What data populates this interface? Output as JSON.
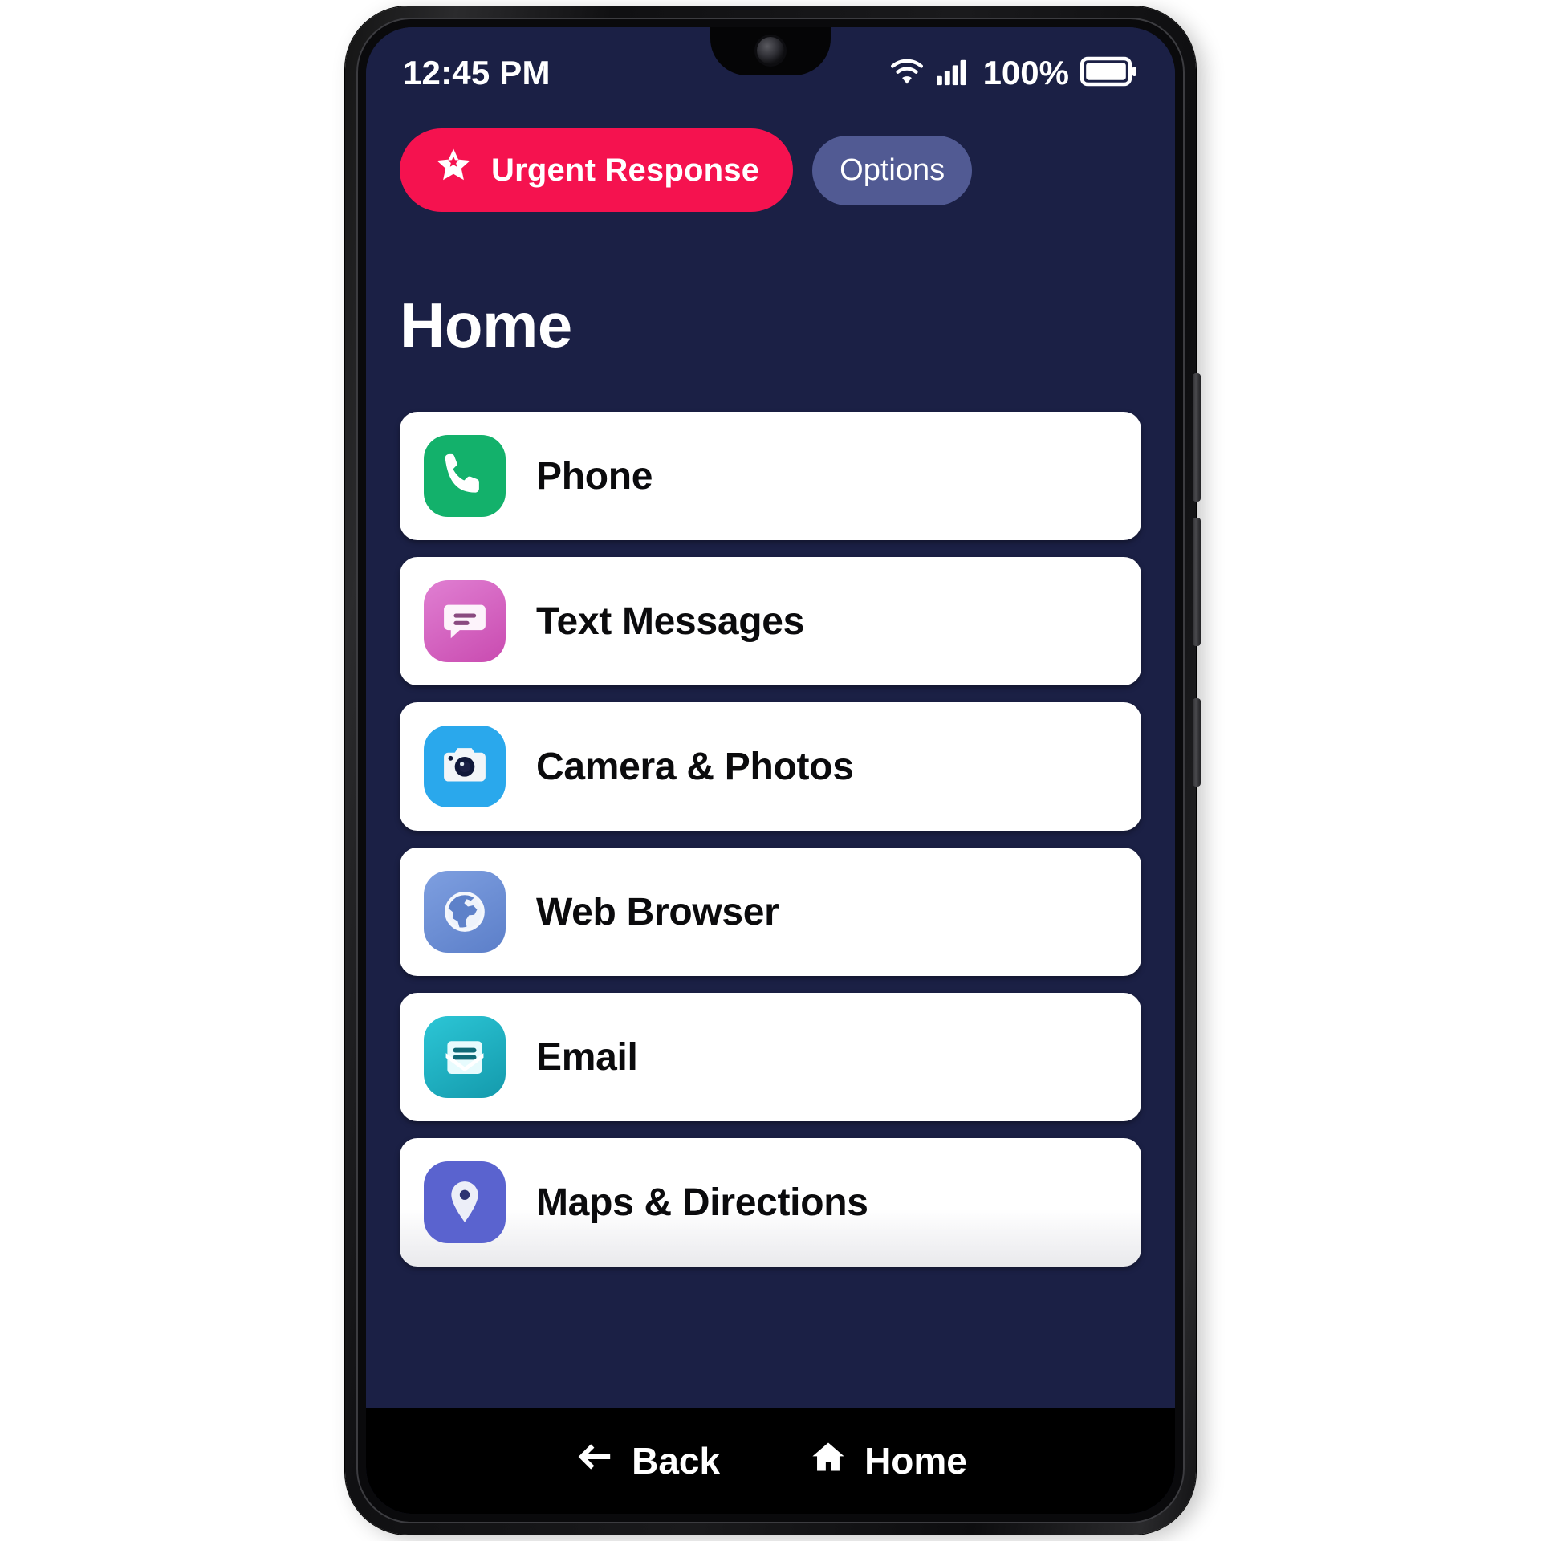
{
  "device": {
    "label": "smartphone",
    "side_buttons": [
      "volume-up",
      "volume-down",
      "power"
    ]
  },
  "status_bar": {
    "time": "12:45 PM",
    "wifi_icon": "wifi-icon",
    "signal_icon": "cellular-signal-icon",
    "battery_percent": "100%",
    "battery_icon": "battery-full-icon",
    "background_color": "#1b2045"
  },
  "header": {
    "urgent_button": {
      "label": "Urgent Response",
      "icon": "star-icon",
      "color": "#f5124f"
    },
    "options_button": {
      "label": "Options",
      "color": "#515a93"
    }
  },
  "page": {
    "title": "Home",
    "background_color": "#1b2045"
  },
  "apps": [
    {
      "label": "Phone",
      "icon": "phone-icon",
      "icon_color": "#13b16b"
    },
    {
      "label": "Text Messages",
      "icon": "message-icon",
      "icon_color": "#d65ec0"
    },
    {
      "label": "Camera & Photos",
      "icon": "camera-icon",
      "icon_color": "#2aa8ec"
    },
    {
      "label": "Web Browser",
      "icon": "globe-icon",
      "icon_color": "#6b8ed6"
    },
    {
      "label": "Email",
      "icon": "envelope-icon",
      "icon_color": "#18b5c4"
    },
    {
      "label": "Maps & Directions",
      "icon": "map-pin-icon",
      "icon_color": "#5a63cf"
    }
  ],
  "nav_bar": {
    "back": {
      "label": "Back",
      "icon": "arrow-left-icon"
    },
    "home": {
      "label": "Home",
      "icon": "house-icon"
    },
    "background_color": "#000000"
  }
}
